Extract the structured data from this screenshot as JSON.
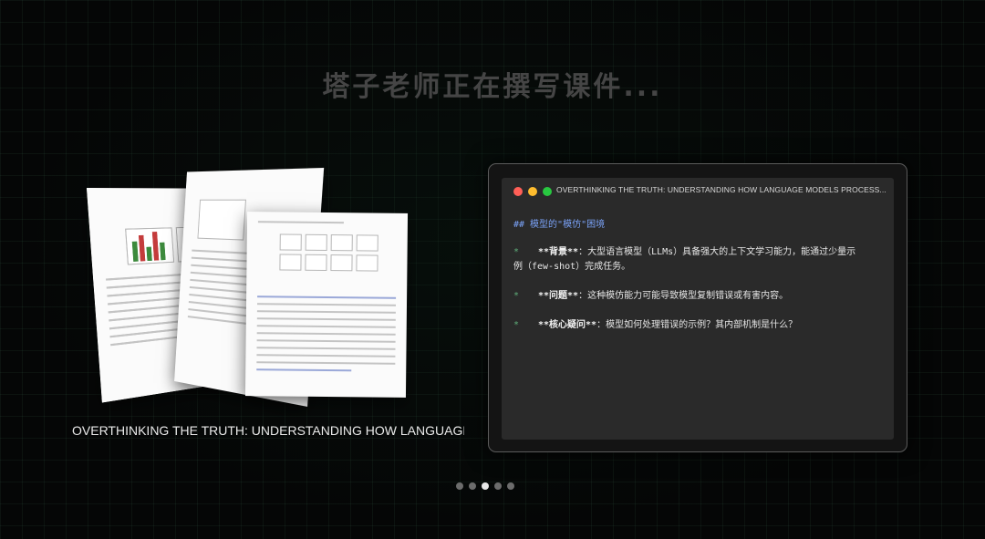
{
  "page": {
    "title": "塔子老师正在撰写课件..."
  },
  "document": {
    "title": "OVERTHINKING THE TRUTH: UNDERSTANDING HOW LANGUAGE ..."
  },
  "editor": {
    "file_name": "OVERTHINKING THE TRUTH: UNDERSTANDING HOW LANGUAGE MODELS PROCESS... .pptx",
    "heading": "## 模型的\"模仿\"困境",
    "bullet_marker": "*",
    "bullets": [
      {
        "key": "**背景**",
        "text": "：大型语言模型（LLMs）具备强大的上下文学习能力，能通过少量示",
        "wrap": "例（few-shot）完成任务。"
      },
      {
        "key": "**问题**",
        "text": "：这种模仿能力可能导致模型复制错误或有害内容。",
        "wrap": ""
      },
      {
        "key": "**核心疑问**",
        "text": "：模型如何处理错误的示例？其内部机制是什么？",
        "wrap": ""
      }
    ]
  },
  "pagination": {
    "total": 5,
    "active_index": 2
  },
  "colors": {
    "background": "#050606",
    "heading_blue": "#7aa2f7",
    "bullet_green": "#5fae7a",
    "traffic_red": "#ff5f57",
    "traffic_yellow": "#febc2e",
    "traffic_green": "#28c840"
  }
}
